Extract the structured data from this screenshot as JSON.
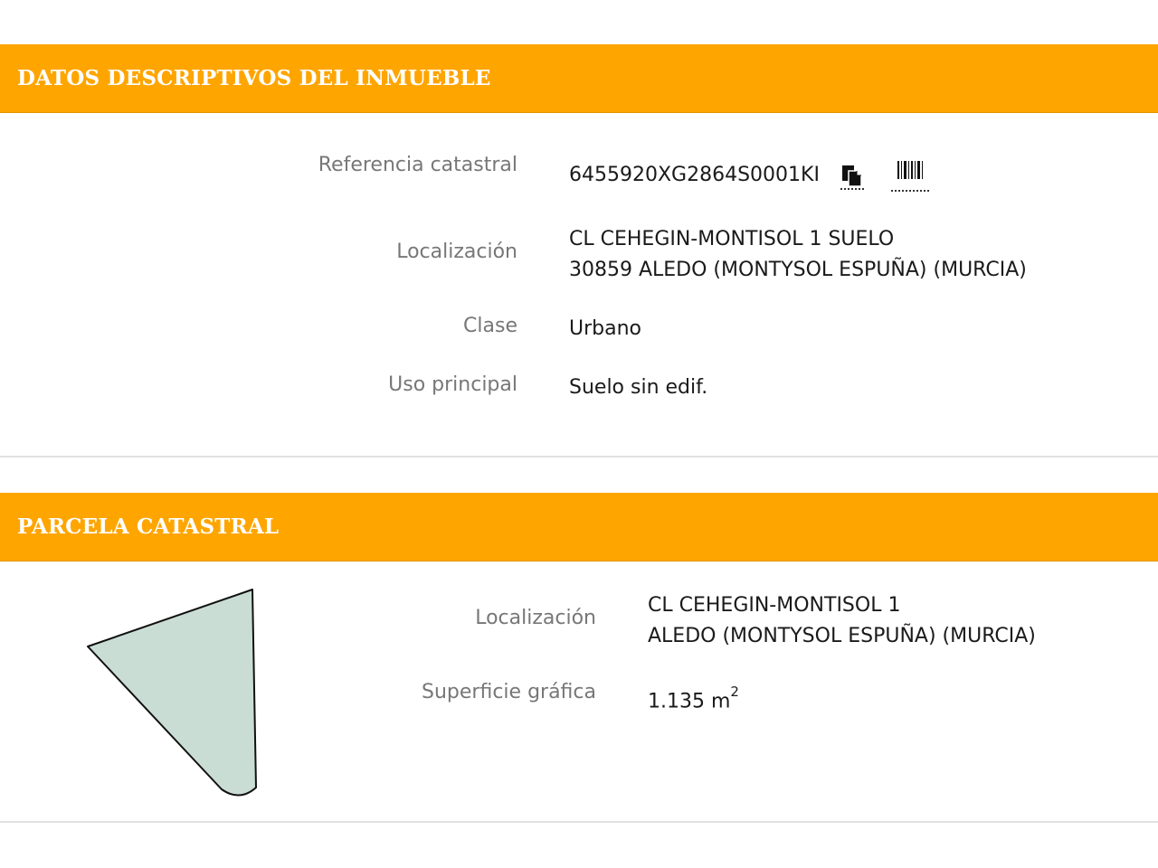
{
  "section1": {
    "title": "DATOS DESCRIPTIVOS DEL INMUEBLE",
    "referencia_label": "Referencia catastral",
    "referencia_value": "6455920XG2864S0001KI",
    "copy_icon": "copy-icon",
    "barcode_icon": "barcode-icon",
    "localizacion_label": "Localización",
    "localizacion_line1": "CL CEHEGIN-MONTISOL 1 SUELO",
    "localizacion_line2": "30859 ALEDO (MONTYSOL ESPUÑA) (MURCIA)",
    "clase_label": "Clase",
    "clase_value": "Urbano",
    "uso_label": "Uso principal",
    "uso_value": "Suelo sin edif."
  },
  "section2": {
    "title": "PARCELA CATASTRAL",
    "localizacion_label": "Localización",
    "localizacion_line1": "CL CEHEGIN-MONTISOL 1",
    "localizacion_line2": "ALEDO (MONTYSOL ESPUÑA) (MURCIA)",
    "superficie_label": "Superficie gráfica",
    "superficie_value": "1.135 m",
    "superficie_unit_sup": "2"
  },
  "colors": {
    "header_bg": "#ffa500",
    "header_text": "#ffffff",
    "label_text": "#777777",
    "value_text": "#1a1a1a",
    "parcel_fill": "#c9ddd5"
  }
}
